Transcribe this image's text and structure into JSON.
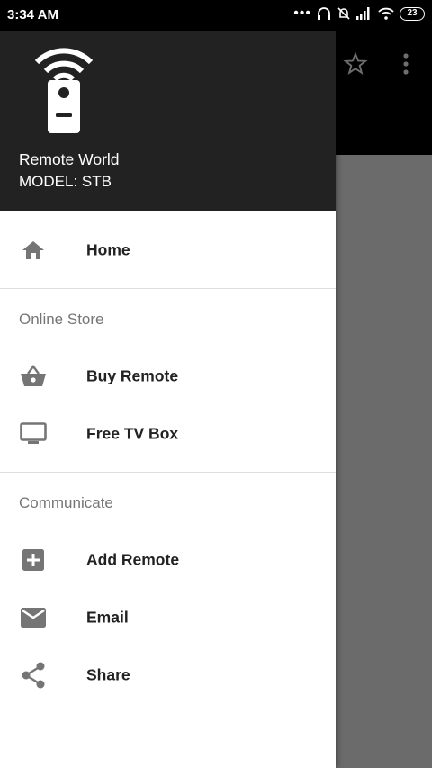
{
  "status": {
    "time": "3:34 AM",
    "battery": "23"
  },
  "drawer": {
    "title": "Remote World",
    "model": "MODEL: STB",
    "items": {
      "home": "Home",
      "buy_remote": "Buy Remote",
      "free_tv_box": "Free TV Box",
      "add_remote": "Add Remote",
      "email": "Email",
      "share": "Share"
    },
    "sections": {
      "online_store": "Online Store",
      "communicate": "Communicate"
    }
  },
  "icons": {
    "home": "home-icon",
    "buy_remote": "basket-icon",
    "free_tv_box": "tv-icon",
    "add_remote": "add-box-icon",
    "email": "mail-icon",
    "share": "share-icon"
  },
  "colors": {
    "drawer_header": "#222222",
    "icon_gray": "#757575",
    "scrim": "#6b6b6b"
  }
}
